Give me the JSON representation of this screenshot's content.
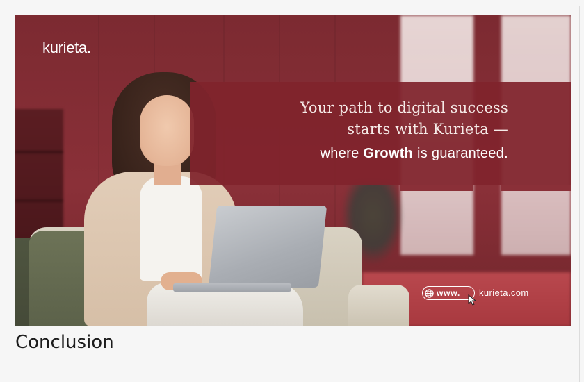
{
  "banner": {
    "logo": "kurieta.",
    "headline": "Your path to digital success\nstarts with Kurieta —",
    "subline_prefix": "where ",
    "subline_emphasis": "Growth",
    "subline_suffix": " is guaranteed.",
    "url_prefix": "www.",
    "url_domain": "kurieta.com",
    "colors": {
      "panel": "#80242c",
      "background": "#7c2a31",
      "text": "#ffffff"
    }
  },
  "content": {
    "heading": "Conclusion"
  },
  "icons": {
    "globe": "globe-icon",
    "cursor": "cursor-icon"
  }
}
